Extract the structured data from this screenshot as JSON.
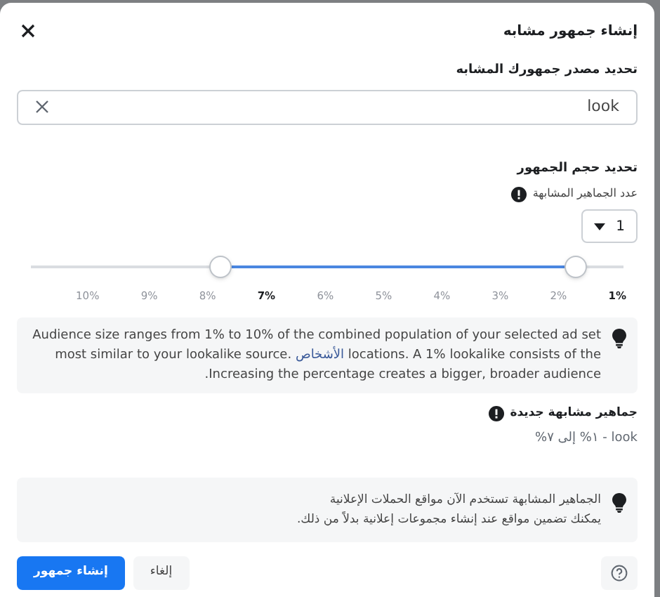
{
  "dialog": {
    "title": "إنشاء جمهور مشابه"
  },
  "source": {
    "label": "تحديد مصدر جمهورك المشابه",
    "value": "look"
  },
  "size": {
    "heading": "تحديد حجم الجمهور",
    "count_label": "عدد الجماهير المشابهة",
    "count_value": "1"
  },
  "slider": {
    "thumbs": [
      {
        "level": 0.32
      },
      {
        "level": 0.92
      }
    ],
    "ticks": [
      {
        "label": "1%",
        "selected": true
      },
      {
        "label": "2%",
        "selected": false
      },
      {
        "label": "3%",
        "selected": false
      },
      {
        "label": "4%",
        "selected": false
      },
      {
        "label": "5%",
        "selected": false
      },
      {
        "label": "6%",
        "selected": false
      },
      {
        "label": "7%",
        "selected": true
      },
      {
        "label": "8%",
        "selected": false
      },
      {
        "label": "9%",
        "selected": false
      },
      {
        "label": "10%",
        "selected": false
      }
    ]
  },
  "tip": {
    "before": "Audience size ranges from 1% to 10% of the combined population of your selected ad set locations. A 1% lookalike consists of the",
    "link": "الأشخاص",
    "after": "most similar to your lookalike source. Increasing the percentage creates a bigger, broader audience."
  },
  "new_audiences": {
    "heading": "جماهير مشابهة جديدة",
    "value": "look - ١% إلى ٧%"
  },
  "notice": {
    "lines": [
      "الجماهير المشابهة تستخدم الآن مواقع الحملات الإعلانية",
      "يمكنك تضمين مواقع عند إنشاء مجموعات إعلانية بدلاً من ذلك."
    ]
  },
  "buttons": {
    "create": "إنشاء جمهور",
    "cancel": "إلغاء"
  }
}
